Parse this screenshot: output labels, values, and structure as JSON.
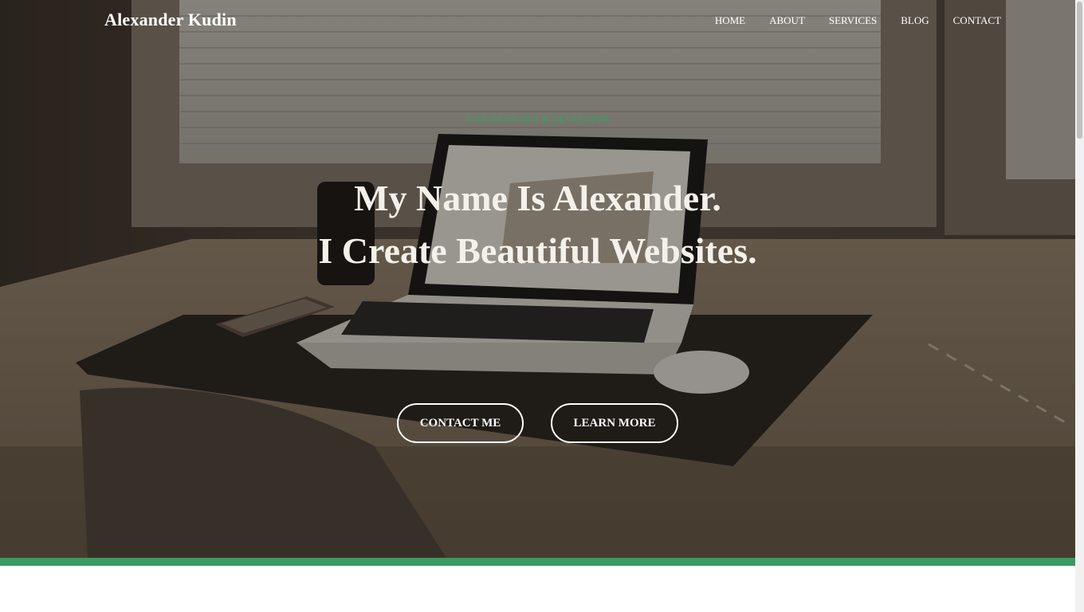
{
  "header": {
    "brand": "Alexander Kudin",
    "nav": [
      "HOME",
      "ABOUT",
      "SERVICES",
      "BLOG",
      "CONTACT"
    ]
  },
  "hero": {
    "tagline": "WEB DESIGNER & DEVELOPER",
    "headline_line1": "My Name Is Alexander.",
    "headline_line2": "I Create Beautiful Websites.",
    "primary_button": "CONTACT ME",
    "secondary_button": "LEARN MORE",
    "background_image": "desk-laptop-photo"
  },
  "colors": {
    "accent": "#2fa462",
    "bar": "#3a9a62",
    "text": "#ffffff"
  }
}
